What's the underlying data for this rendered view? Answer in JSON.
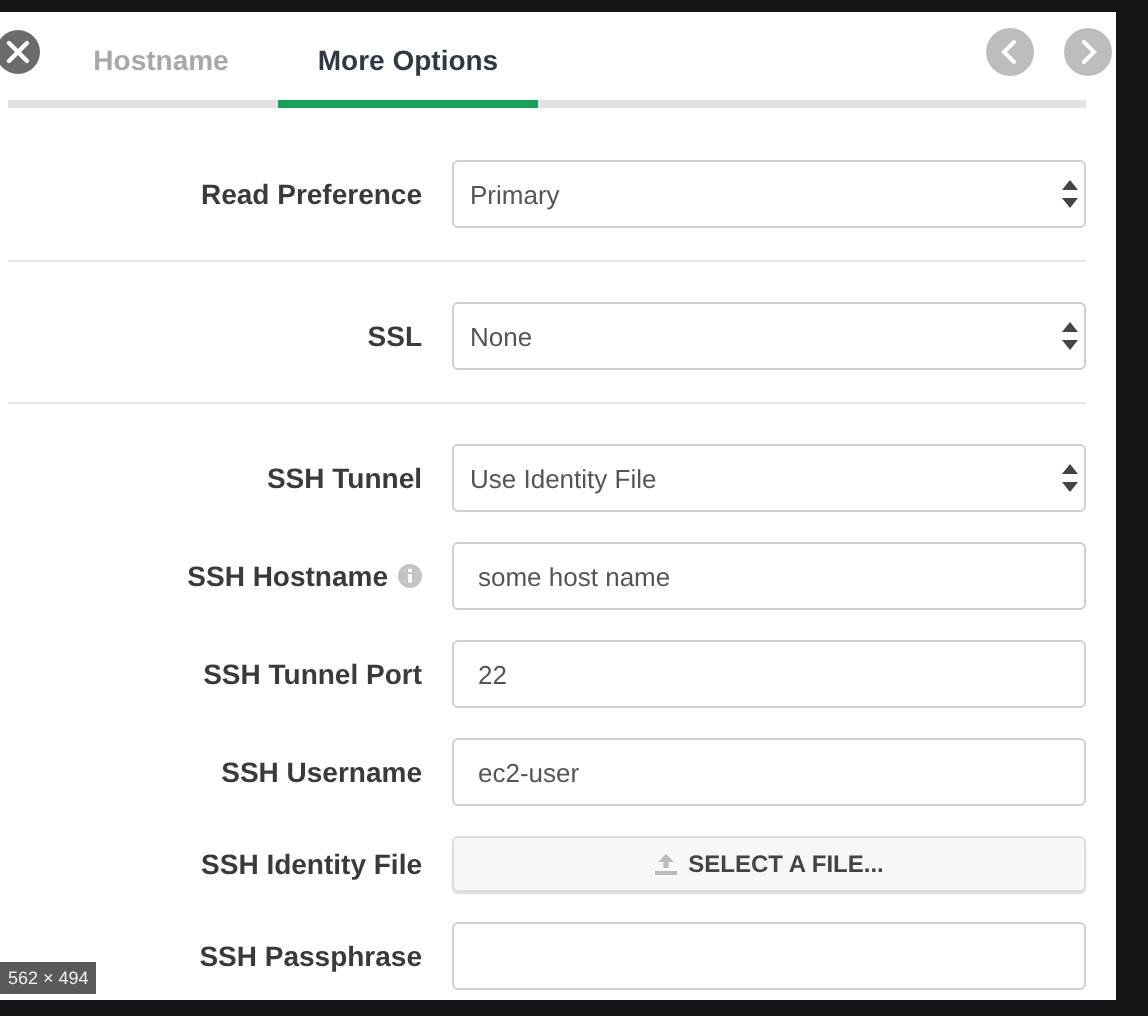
{
  "tabs": [
    {
      "label": "Hostname",
      "selected": false
    },
    {
      "label": "More Options",
      "selected": true
    }
  ],
  "sections": [
    {
      "fields": [
        {
          "kind": "select",
          "label": "Read Preference",
          "value": "Primary"
        }
      ]
    },
    {
      "fields": [
        {
          "kind": "select",
          "label": "SSL",
          "value": "None"
        }
      ]
    },
    {
      "fields": [
        {
          "kind": "select",
          "label": "SSH Tunnel",
          "value": "Use Identity File"
        },
        {
          "kind": "text",
          "label": "SSH Hostname",
          "info": true,
          "value": "some host name"
        },
        {
          "kind": "text",
          "label": "SSH Tunnel Port",
          "value": "22"
        },
        {
          "kind": "text",
          "label": "SSH Username",
          "value": "ec2-user"
        },
        {
          "kind": "file",
          "label": "SSH Identity File",
          "button": "SELECT A FILE..."
        },
        {
          "kind": "text",
          "label": "SSH Passphrase"
        }
      ]
    }
  ],
  "size_badge": "562 × 494"
}
